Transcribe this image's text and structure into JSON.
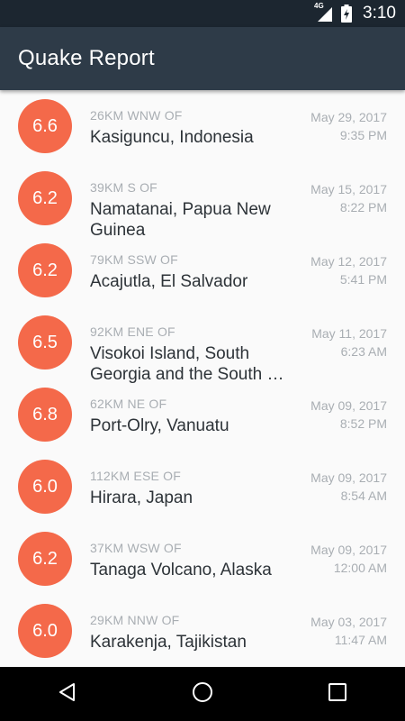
{
  "status_bar": {
    "network_label": "4G",
    "time": "3:10",
    "icons": [
      "signal-icon",
      "battery-charging-icon"
    ]
  },
  "app_bar": {
    "title": "Quake Report"
  },
  "colors": {
    "magnitude_circle": "#f4694a",
    "app_bar": "#2e3b48",
    "status_bar": "#1c2630"
  },
  "earthquakes": [
    {
      "magnitude": "6.6",
      "location_offset": "26km WNW of",
      "primary_location": "Kasiguncu, Indonesia",
      "date": "May 29, 2017",
      "time": "9:35 PM"
    },
    {
      "magnitude": "6.2",
      "location_offset": "39km S of",
      "primary_location": "Namatanai, Papua New Guinea",
      "date": "May 15, 2017",
      "time": "8:22 PM"
    },
    {
      "magnitude": "6.2",
      "location_offset": "79km SSW of",
      "primary_location": "Acajutla, El Salvador",
      "date": "May 12, 2017",
      "time": "5:41 PM"
    },
    {
      "magnitude": "6.5",
      "location_offset": "92km ENE of",
      "primary_location": "Visokoi Island, South Georgia and the South …",
      "date": "May 11, 2017",
      "time": "6:23 AM"
    },
    {
      "magnitude": "6.8",
      "location_offset": "62km NE of",
      "primary_location": "Port-Olry, Vanuatu",
      "date": "May 09, 2017",
      "time": "8:52 PM"
    },
    {
      "magnitude": "6.0",
      "location_offset": "112km ESE of",
      "primary_location": "Hirara, Japan",
      "date": "May 09, 2017",
      "time": "8:54 AM"
    },
    {
      "magnitude": "6.2",
      "location_offset": "37km WSW of",
      "primary_location": "Tanaga Volcano, Alaska",
      "date": "May 09, 2017",
      "time": "12:00 AM"
    },
    {
      "magnitude": "6.0",
      "location_offset": "29km NNW of",
      "primary_location": "Karakenja, Tajikistan",
      "date": "May 03, 2017",
      "time": "11:47 AM"
    }
  ],
  "nav_bar": {
    "buttons": [
      "back-icon",
      "home-icon",
      "recents-icon"
    ]
  }
}
